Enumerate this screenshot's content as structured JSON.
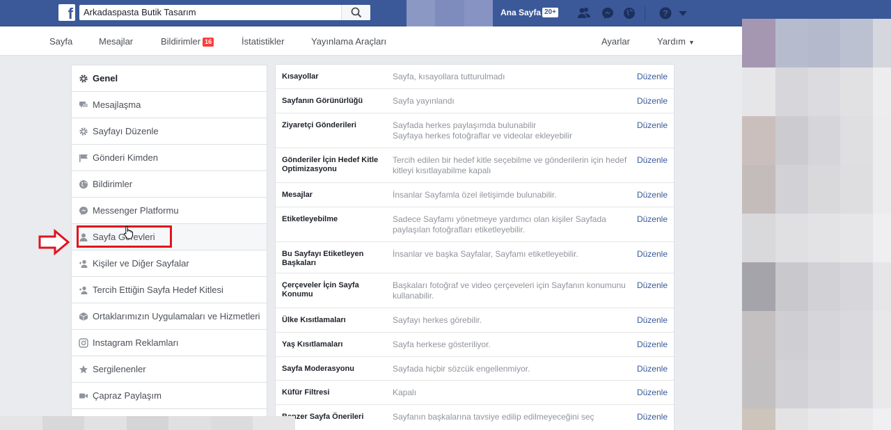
{
  "topbar": {
    "search_value": "Arkadaspasta Butik Tasarım",
    "home_label": "Ana Sayfa",
    "home_badge": "20+",
    "icons": [
      "friends-icon",
      "messenger-icon",
      "globe-icon",
      "help-icon",
      "caret-down-icon"
    ]
  },
  "page_nav": {
    "items": [
      {
        "label": "Sayfa"
      },
      {
        "label": "Mesajlar"
      },
      {
        "label": "Bildirimler",
        "badge": "16"
      },
      {
        "label": "İstatistikler"
      },
      {
        "label": "Yayınlama Araçları"
      }
    ],
    "settings_label": "Ayarlar",
    "help_label": "Yardım"
  },
  "left_menu": {
    "items": [
      {
        "label": "Genel",
        "icon": "gear-icon",
        "active": true
      },
      {
        "label": "Mesajlaşma",
        "icon": "chat-bubbles-icon"
      },
      {
        "label": "Sayfayı Düzenle",
        "icon": "gear-icon"
      },
      {
        "label": "Gönderi Kimden",
        "icon": "flag-icon"
      },
      {
        "label": "Bildirimler",
        "icon": "globe-icon"
      },
      {
        "label": "Messenger Platformu",
        "icon": "messenger-icon"
      },
      {
        "label": "Sayfa Görevleri",
        "icon": "person-icon"
      },
      {
        "label": "Kişiler ve Diğer Sayfalar",
        "icon": "people-icon"
      },
      {
        "label": "Tercih Ettiğin Sayfa Hedef Kitlesi",
        "icon": "people-icon"
      },
      {
        "label": "Ortaklarımızın Uygulamaları ve Hizmetleri",
        "icon": "cube-icon"
      },
      {
        "label": "Instagram Reklamları",
        "icon": "instagram-icon"
      },
      {
        "label": "Sergilenenler",
        "icon": "star-icon"
      },
      {
        "label": "Çapraz Paylaşım",
        "icon": "video-camera-icon"
      }
    ]
  },
  "settings": {
    "edit_label": "Düzenle",
    "rows": [
      {
        "name": "Kısayollar",
        "value": "Sayfa, kısayollara tutturulmadı"
      },
      {
        "name": "Sayfanın Görünürlüğü",
        "value": "Sayfa yayınlandı"
      },
      {
        "name": "Ziyaretçi Gönderileri",
        "value": "Sayfada herkes paylaşımda bulunabilir\nSayfaya herkes fotoğraflar ve videolar ekleyebilir"
      },
      {
        "name": "Gönderiler İçin Hedef Kitle Optimizasyonu",
        "value": "Tercih edilen bir hedef kitle seçebilme ve gönderilerin için hedef kitleyi kısıtlayabilme kapalı"
      },
      {
        "name": "Mesajlar",
        "value": "İnsanlar Sayfamla özel iletişimde bulunabilir."
      },
      {
        "name": "Etiketleyebilme",
        "value": "Sadece Sayfamı yönetmeye yardımcı olan kişiler Sayfada paylaşılan fotoğrafları etiketleyebilir."
      },
      {
        "name": "Bu Sayfayı Etiketleyen Başkaları",
        "value": "İnsanlar ve başka Sayfalar, Sayfamı etiketleyebilir."
      },
      {
        "name": "Çerçeveler İçin Sayfa Konumu",
        "value": "Başkaları fotoğraf ve video çerçeveleri için Sayfanın konumunu kullanabilir."
      },
      {
        "name": "Ülke Kısıtlamaları",
        "value": "Sayfayı herkes görebilir."
      },
      {
        "name": "Yaş Kısıtlamaları",
        "value": "Sayfa herkese gösteriliyor."
      },
      {
        "name": "Sayfa Moderasyonu",
        "value": "Sayfada hiçbir sözcük engellenmiyor."
      },
      {
        "name": "Küfür Filtresi",
        "value": "Kapalı"
      },
      {
        "name": "Benzer Sayfa Önerileri",
        "value": "Sayfanın başkalarına tavsiye edilip edilmeyeceğini seç"
      }
    ]
  },
  "colors": {
    "topbar": "#3b5998",
    "link": "#365899",
    "badge": "#fa3e3e",
    "highlight": "#e0141e"
  }
}
